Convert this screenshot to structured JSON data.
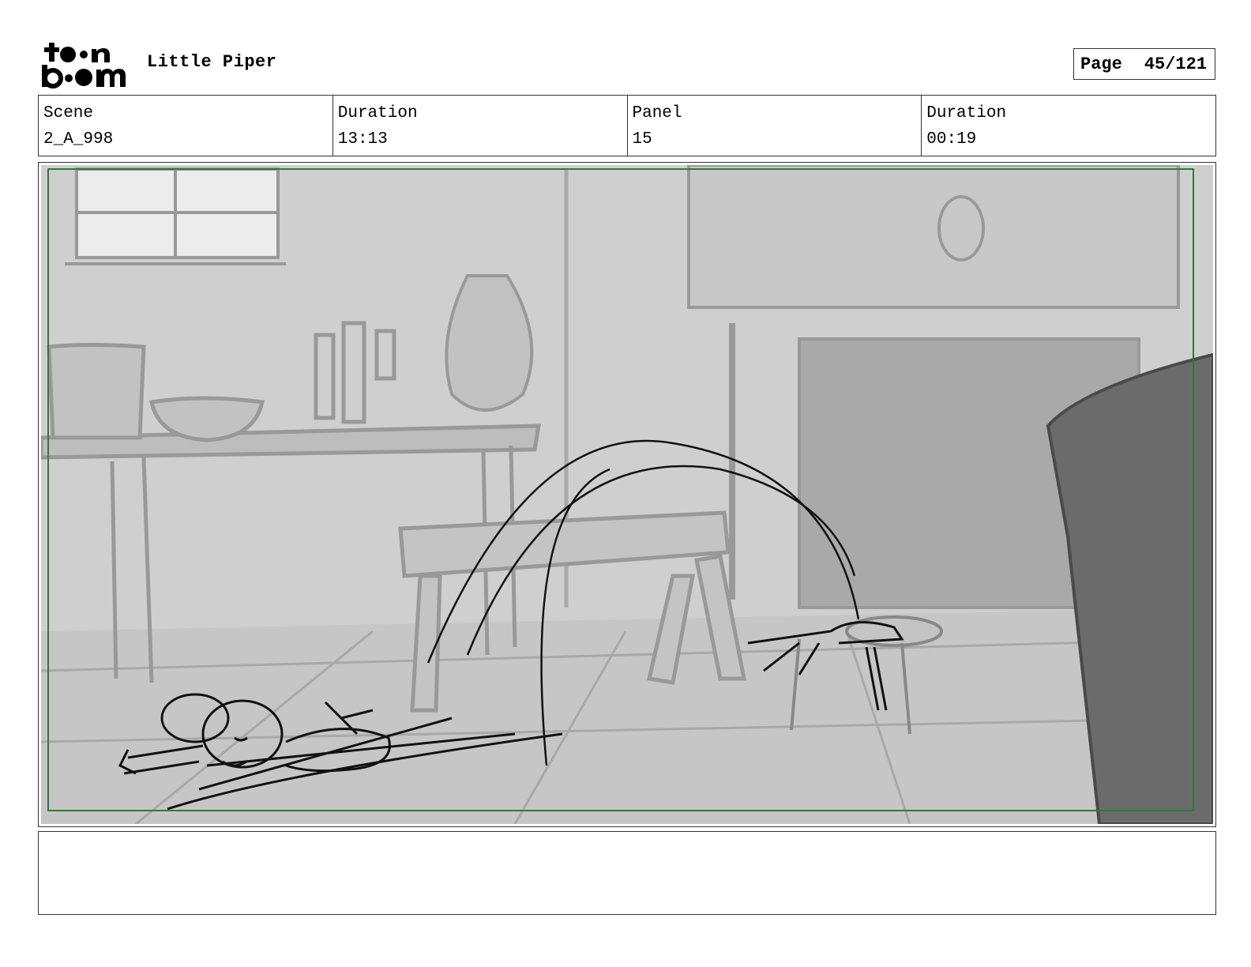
{
  "header": {
    "logo": {
      "text": "toon boom",
      "icon": "toon-boom-logo"
    },
    "project_title": "Little Piper",
    "page_label": "Page",
    "page_value": "45/121"
  },
  "info": {
    "scene_label": "Scene",
    "scene_value": "2_A_998",
    "scene_duration_label": "Duration",
    "scene_duration_value": "13:13",
    "panel_label": "Panel",
    "panel_value": "15",
    "panel_duration_label": "Duration",
    "panel_duration_value": "00:19"
  },
  "panel_image": {
    "subject": "storyboard-sketch",
    "safe_frame_color": "#2e7d32",
    "background_color": "#cfcfcf"
  },
  "notes": {
    "text": ""
  }
}
